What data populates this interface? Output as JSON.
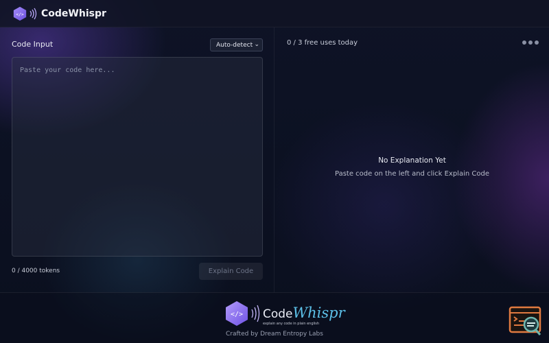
{
  "header": {
    "title": "CodeWhispr"
  },
  "editor": {
    "label": "Code Input",
    "language_selected": "Auto-detect",
    "placeholder": "Paste your code here...",
    "token_count": "0 / 4000 tokens",
    "explain_label": "Explain Code"
  },
  "output": {
    "usage": "0 / 3 free uses today",
    "empty_title": "No Explanation Yet",
    "empty_subtitle": "Paste code on the left and click Explain Code"
  },
  "footer": {
    "logo_word_plain": "Code",
    "logo_word_fancy": "Whispr",
    "tagline": "explain any code in plain english",
    "credit": "Crafted by Dream Entropy Labs"
  },
  "colors": {
    "accent_purple": "#8b6cf0",
    "accent_cyan": "#5cc0e8",
    "help_icon_orange": "#e07a40"
  },
  "icons": {
    "logo": "hexagon-code-icon",
    "more": "more-dots-icon",
    "help": "terminal-search-icon"
  }
}
